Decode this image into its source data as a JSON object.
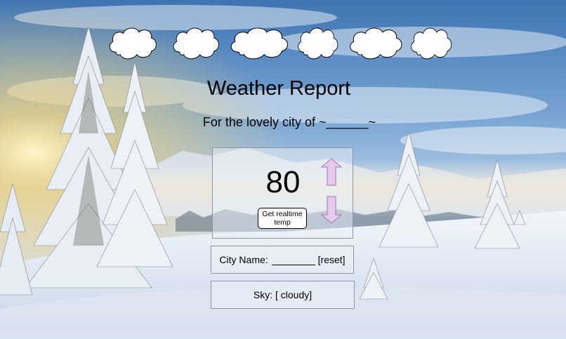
{
  "header": {
    "title": "Weather Report",
    "subtitle": "For the lovely city of ~______~"
  },
  "clouds": {
    "count": 6,
    "icon": "cloud-icon",
    "fill": "#ffffff",
    "stroke": "#000000"
  },
  "temperature": {
    "value": "80",
    "button_label": "Get realtime temp",
    "arrow_fill": "#e8c9ee",
    "arrow_stroke": "#9b7ab0"
  },
  "city": {
    "label": "City Name:",
    "reset_label": "[reset]"
  },
  "sky": {
    "label": "Sky: [ cloudy]"
  },
  "colors": {
    "panel_bg": "rgba(236,241,248,0.5)",
    "panel_border": "#8f96a0",
    "sky_top": "#4d7fba",
    "snow": "#edf3fa"
  }
}
